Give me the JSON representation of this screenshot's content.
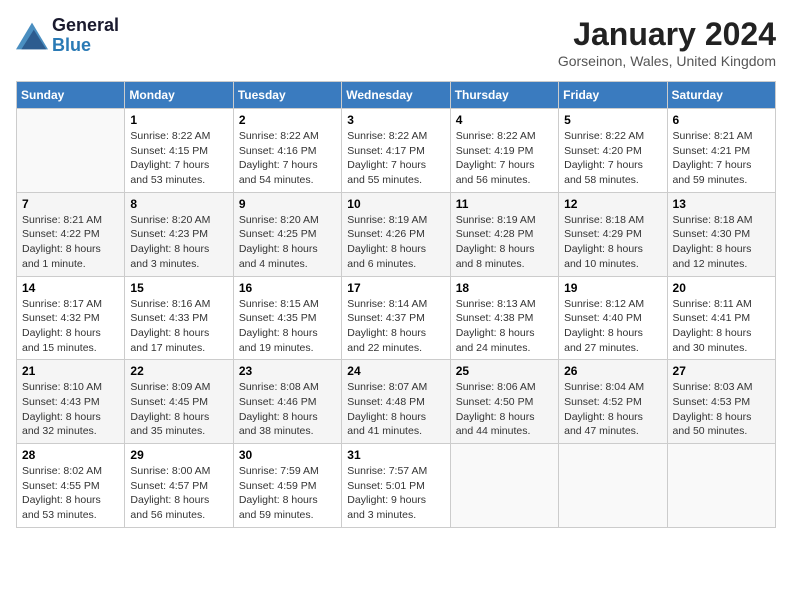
{
  "header": {
    "logo_general": "General",
    "logo_blue": "Blue",
    "month_title": "January 2024",
    "location": "Gorseinon, Wales, United Kingdom"
  },
  "weekdays": [
    "Sunday",
    "Monday",
    "Tuesday",
    "Wednesday",
    "Thursday",
    "Friday",
    "Saturday"
  ],
  "weeks": [
    [
      {
        "day": "",
        "sunrise": "",
        "sunset": "",
        "daylight": ""
      },
      {
        "day": "1",
        "sunrise": "Sunrise: 8:22 AM",
        "sunset": "Sunset: 4:15 PM",
        "daylight": "Daylight: 7 hours and 53 minutes."
      },
      {
        "day": "2",
        "sunrise": "Sunrise: 8:22 AM",
        "sunset": "Sunset: 4:16 PM",
        "daylight": "Daylight: 7 hours and 54 minutes."
      },
      {
        "day": "3",
        "sunrise": "Sunrise: 8:22 AM",
        "sunset": "Sunset: 4:17 PM",
        "daylight": "Daylight: 7 hours and 55 minutes."
      },
      {
        "day": "4",
        "sunrise": "Sunrise: 8:22 AM",
        "sunset": "Sunset: 4:19 PM",
        "daylight": "Daylight: 7 hours and 56 minutes."
      },
      {
        "day": "5",
        "sunrise": "Sunrise: 8:22 AM",
        "sunset": "Sunset: 4:20 PM",
        "daylight": "Daylight: 7 hours and 58 minutes."
      },
      {
        "day": "6",
        "sunrise": "Sunrise: 8:21 AM",
        "sunset": "Sunset: 4:21 PM",
        "daylight": "Daylight: 7 hours and 59 minutes."
      }
    ],
    [
      {
        "day": "7",
        "sunrise": "Sunrise: 8:21 AM",
        "sunset": "Sunset: 4:22 PM",
        "daylight": "Daylight: 8 hours and 1 minute."
      },
      {
        "day": "8",
        "sunrise": "Sunrise: 8:20 AM",
        "sunset": "Sunset: 4:23 PM",
        "daylight": "Daylight: 8 hours and 3 minutes."
      },
      {
        "day": "9",
        "sunrise": "Sunrise: 8:20 AM",
        "sunset": "Sunset: 4:25 PM",
        "daylight": "Daylight: 8 hours and 4 minutes."
      },
      {
        "day": "10",
        "sunrise": "Sunrise: 8:19 AM",
        "sunset": "Sunset: 4:26 PM",
        "daylight": "Daylight: 8 hours and 6 minutes."
      },
      {
        "day": "11",
        "sunrise": "Sunrise: 8:19 AM",
        "sunset": "Sunset: 4:28 PM",
        "daylight": "Daylight: 8 hours and 8 minutes."
      },
      {
        "day": "12",
        "sunrise": "Sunrise: 8:18 AM",
        "sunset": "Sunset: 4:29 PM",
        "daylight": "Daylight: 8 hours and 10 minutes."
      },
      {
        "day": "13",
        "sunrise": "Sunrise: 8:18 AM",
        "sunset": "Sunset: 4:30 PM",
        "daylight": "Daylight: 8 hours and 12 minutes."
      }
    ],
    [
      {
        "day": "14",
        "sunrise": "Sunrise: 8:17 AM",
        "sunset": "Sunset: 4:32 PM",
        "daylight": "Daylight: 8 hours and 15 minutes."
      },
      {
        "day": "15",
        "sunrise": "Sunrise: 8:16 AM",
        "sunset": "Sunset: 4:33 PM",
        "daylight": "Daylight: 8 hours and 17 minutes."
      },
      {
        "day": "16",
        "sunrise": "Sunrise: 8:15 AM",
        "sunset": "Sunset: 4:35 PM",
        "daylight": "Daylight: 8 hours and 19 minutes."
      },
      {
        "day": "17",
        "sunrise": "Sunrise: 8:14 AM",
        "sunset": "Sunset: 4:37 PM",
        "daylight": "Daylight: 8 hours and 22 minutes."
      },
      {
        "day": "18",
        "sunrise": "Sunrise: 8:13 AM",
        "sunset": "Sunset: 4:38 PM",
        "daylight": "Daylight: 8 hours and 24 minutes."
      },
      {
        "day": "19",
        "sunrise": "Sunrise: 8:12 AM",
        "sunset": "Sunset: 4:40 PM",
        "daylight": "Daylight: 8 hours and 27 minutes."
      },
      {
        "day": "20",
        "sunrise": "Sunrise: 8:11 AM",
        "sunset": "Sunset: 4:41 PM",
        "daylight": "Daylight: 8 hours and 30 minutes."
      }
    ],
    [
      {
        "day": "21",
        "sunrise": "Sunrise: 8:10 AM",
        "sunset": "Sunset: 4:43 PM",
        "daylight": "Daylight: 8 hours and 32 minutes."
      },
      {
        "day": "22",
        "sunrise": "Sunrise: 8:09 AM",
        "sunset": "Sunset: 4:45 PM",
        "daylight": "Daylight: 8 hours and 35 minutes."
      },
      {
        "day": "23",
        "sunrise": "Sunrise: 8:08 AM",
        "sunset": "Sunset: 4:46 PM",
        "daylight": "Daylight: 8 hours and 38 minutes."
      },
      {
        "day": "24",
        "sunrise": "Sunrise: 8:07 AM",
        "sunset": "Sunset: 4:48 PM",
        "daylight": "Daylight: 8 hours and 41 minutes."
      },
      {
        "day": "25",
        "sunrise": "Sunrise: 8:06 AM",
        "sunset": "Sunset: 4:50 PM",
        "daylight": "Daylight: 8 hours and 44 minutes."
      },
      {
        "day": "26",
        "sunrise": "Sunrise: 8:04 AM",
        "sunset": "Sunset: 4:52 PM",
        "daylight": "Daylight: 8 hours and 47 minutes."
      },
      {
        "day": "27",
        "sunrise": "Sunrise: 8:03 AM",
        "sunset": "Sunset: 4:53 PM",
        "daylight": "Daylight: 8 hours and 50 minutes."
      }
    ],
    [
      {
        "day": "28",
        "sunrise": "Sunrise: 8:02 AM",
        "sunset": "Sunset: 4:55 PM",
        "daylight": "Daylight: 8 hours and 53 minutes."
      },
      {
        "day": "29",
        "sunrise": "Sunrise: 8:00 AM",
        "sunset": "Sunset: 4:57 PM",
        "daylight": "Daylight: 8 hours and 56 minutes."
      },
      {
        "day": "30",
        "sunrise": "Sunrise: 7:59 AM",
        "sunset": "Sunset: 4:59 PM",
        "daylight": "Daylight: 8 hours and 59 minutes."
      },
      {
        "day": "31",
        "sunrise": "Sunrise: 7:57 AM",
        "sunset": "Sunset: 5:01 PM",
        "daylight": "Daylight: 9 hours and 3 minutes."
      },
      {
        "day": "",
        "sunrise": "",
        "sunset": "",
        "daylight": ""
      },
      {
        "day": "",
        "sunrise": "",
        "sunset": "",
        "daylight": ""
      },
      {
        "day": "",
        "sunrise": "",
        "sunset": "",
        "daylight": ""
      }
    ]
  ]
}
